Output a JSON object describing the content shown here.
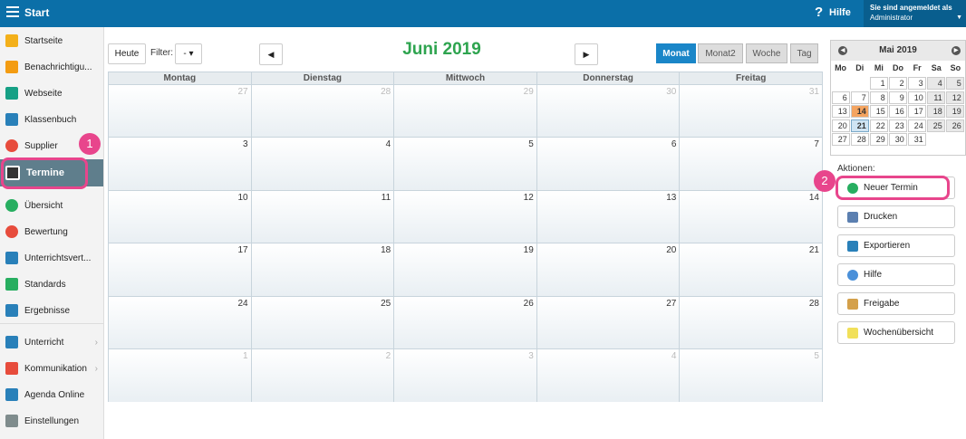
{
  "topbar": {
    "title": "Start",
    "help_label": "Hilfe",
    "user_line1": "Sie sind angemeldet als",
    "user_line2": "Administrator"
  },
  "sidebar": {
    "items": [
      {
        "label": "Startseite",
        "icon": "star-icon",
        "color": "#f3b01a"
      },
      {
        "label": "Benachrichtigu...",
        "icon": "envelope-icon",
        "color": "#f39c12"
      },
      {
        "label": "Webseite",
        "icon": "home-icon",
        "color": "#16a085"
      },
      {
        "label": "Klassenbuch",
        "icon": "book-icon",
        "color": "#2980b9"
      },
      {
        "label": "Supplier",
        "icon": "person-icon",
        "color": "#e74c3c"
      },
      {
        "label": "Termine",
        "icon": "calendar-icon",
        "color": "#ffffff"
      },
      {
        "label": "Übersicht",
        "icon": "check-circle-icon",
        "color": "#27ae60"
      },
      {
        "label": "Bewertung",
        "icon": "grade-icon",
        "color": "#e74c3c"
      },
      {
        "label": "Unterrichtsvert...",
        "icon": "briefcase-icon",
        "color": "#2980b9"
      },
      {
        "label": "Standards",
        "icon": "shield-icon",
        "color": "#27ae60"
      },
      {
        "label": "Ergebnisse",
        "icon": "bar-chart-icon",
        "color": "#2980b9"
      },
      {
        "label": "Unterricht",
        "icon": "folder-icon",
        "color": "#2980b9"
      },
      {
        "label": "Kommunikation",
        "icon": "chat-icon",
        "color": "#e74c3c"
      },
      {
        "label": "Agenda Online",
        "icon": "pen-icon",
        "color": "#2980b9"
      },
      {
        "label": "Einstellungen",
        "icon": "gear-icon",
        "color": "#7f8c8d"
      }
    ]
  },
  "toolbar": {
    "today_label": "Heute",
    "filter_label": "Filter:",
    "filter_value": "- ▾",
    "prev_symbol": "◀",
    "next_symbol": "▶",
    "month_title": "Juni 2019",
    "views": [
      "Monat",
      "Monat2",
      "Woche",
      "Tag"
    ],
    "active_view": "Monat"
  },
  "calendar": {
    "weekdays": [
      "Montag",
      "Dienstag",
      "Mittwoch",
      "Donnerstag",
      "Freitag"
    ],
    "weeks": [
      [
        {
          "d": "27",
          "o": true
        },
        {
          "d": "28",
          "o": true
        },
        {
          "d": "29",
          "o": true
        },
        {
          "d": "30",
          "o": true
        },
        {
          "d": "31",
          "o": true
        }
      ],
      [
        {
          "d": "3"
        },
        {
          "d": "4"
        },
        {
          "d": "5"
        },
        {
          "d": "6"
        },
        {
          "d": "7"
        }
      ],
      [
        {
          "d": "10"
        },
        {
          "d": "11"
        },
        {
          "d": "12"
        },
        {
          "d": "13"
        },
        {
          "d": "14"
        }
      ],
      [
        {
          "d": "17"
        },
        {
          "d": "18"
        },
        {
          "d": "19"
        },
        {
          "d": "20"
        },
        {
          "d": "21"
        }
      ],
      [
        {
          "d": "24"
        },
        {
          "d": "25"
        },
        {
          "d": "26"
        },
        {
          "d": "27"
        },
        {
          "d": "28"
        }
      ],
      [
        {
          "d": "1",
          "o": true
        },
        {
          "d": "2",
          "o": true
        },
        {
          "d": "3",
          "o": true
        },
        {
          "d": "4",
          "o": true
        },
        {
          "d": "5",
          "o": true
        }
      ]
    ]
  },
  "mini_calendar": {
    "title": "Mai 2019",
    "prev_symbol": "◀",
    "next_symbol": "▶",
    "dow": [
      "Mo",
      "Di",
      "Mi",
      "Do",
      "Fr",
      "Sa",
      "So"
    ],
    "weeks": [
      [
        "",
        "",
        "1",
        "2",
        "3",
        "4",
        "5"
      ],
      [
        "6",
        "7",
        "8",
        "9",
        "10",
        "11",
        "12"
      ],
      [
        "13",
        "14",
        "15",
        "16",
        "17",
        "18",
        "19"
      ],
      [
        "20",
        "21",
        "22",
        "23",
        "24",
        "25",
        "26"
      ],
      [
        "27",
        "28",
        "29",
        "30",
        "31",
        "",
        ""
      ]
    ],
    "today": "14",
    "selected": "21"
  },
  "actions": {
    "label": "Aktionen:",
    "items": [
      {
        "label": "Neuer Termin",
        "icon": "plus-circle-icon",
        "color": "#27ae60"
      },
      {
        "label": "Drucken",
        "icon": "printer-icon",
        "color": "#5b7fb0"
      },
      {
        "label": "Exportieren",
        "icon": "export-icon",
        "color": "#2980b9"
      },
      {
        "label": "Hilfe",
        "icon": "help-circle-icon",
        "color": "#4a90d9"
      },
      {
        "label": "Freigabe",
        "icon": "share-icon",
        "color": "#d4a04a"
      },
      {
        "label": "Wochenübersicht",
        "icon": "note-icon",
        "color": "#f1e05a"
      }
    ]
  },
  "callouts": [
    "1",
    "2"
  ]
}
